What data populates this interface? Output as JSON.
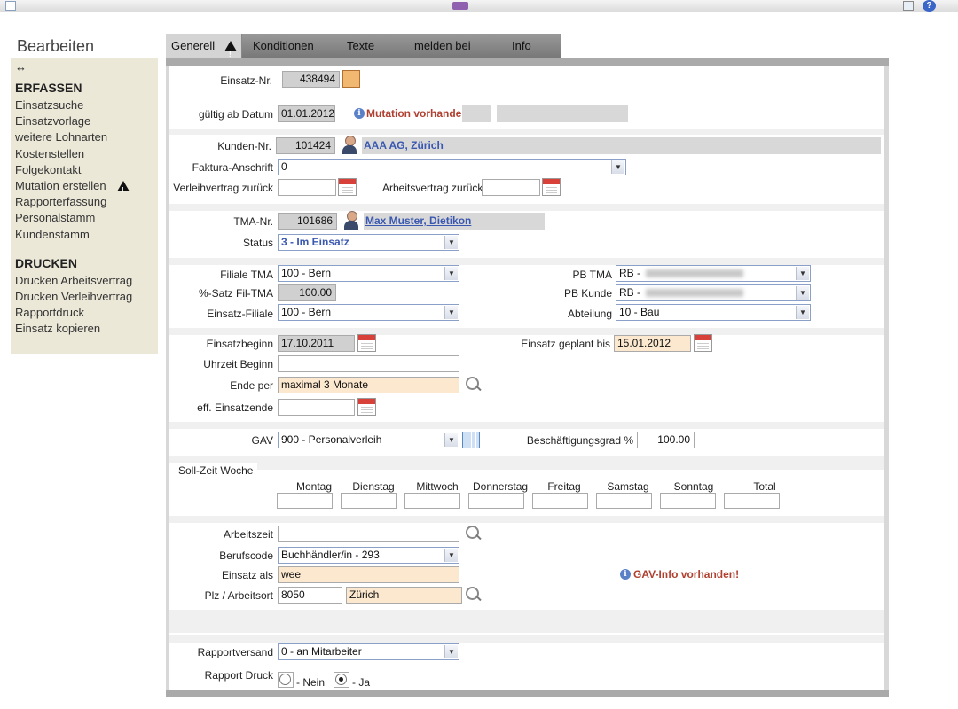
{
  "sidebar": {
    "title": "Bearbeiten",
    "resize_glyph": "↔",
    "sections": [
      {
        "heading": "ERFASSEN",
        "items": [
          "Einsatzsuche",
          "Einsatzvorlage",
          "weitere Lohnarten",
          "Kostenstellen",
          "Folgekontakt",
          "Mutation erstellen",
          "Rapporterfassung",
          "Personalstamm",
          "Kundenstamm"
        ]
      },
      {
        "heading": "DRUCKEN",
        "items": [
          "Drucken Arbeitsvertrag",
          "Drucken Verleihvertrag",
          "Rapportdruck",
          "Einsatz kopieren"
        ]
      }
    ]
  },
  "tabs": [
    "Generell",
    "Konditionen",
    "Texte",
    "melden bei",
    "Info"
  ],
  "form": {
    "einsatz_nr_label": "Einsatz-Nr.",
    "einsatz_nr": "438494",
    "gueltig_label": "gültig ab Datum",
    "gueltig": "01.01.2012",
    "mutation_text": "Mutation vorhanden",
    "kunden_nr_label": "Kunden-Nr.",
    "kunden_nr": "101424",
    "kunde_name": "AAA AG, Zürich",
    "faktura_label": "Faktura-Anschrift",
    "faktura": "0",
    "verleih_label": "Verleihvertrag zurück",
    "arbeits_label": "Arbeitsvertrag zurück",
    "tma_nr_label": "TMA-Nr.",
    "tma_nr": "101686",
    "tma_name": "Max Muster, Dietikon",
    "status_label": "Status",
    "status": "3 - Im Einsatz",
    "filiale_tma_label": "Filiale TMA",
    "filiale_tma": "100 - Bern",
    "satz_label": "%-Satz Fil-TMA",
    "satz": "100.00",
    "einsatz_filiale_label": "Einsatz-Filiale",
    "einsatz_filiale": "100 - Bern",
    "pb_tma_label": "PB TMA",
    "pb_tma": "RB -",
    "pb_kunde_label": "PB Kunde",
    "pb_kunde": "RB -",
    "abteilung_label": "Abteilung",
    "abteilung": "10 - Bau",
    "einsatzbeginn_label": "Einsatzbeginn",
    "einsatzbeginn": "17.10.2011",
    "geplant_label": "Einsatz geplant bis",
    "geplant": "15.01.2012",
    "uhrzeit_label": "Uhrzeit Beginn",
    "ende_label": "Ende per",
    "ende": "maximal 3 Monate",
    "eff_label": "eff. Einsatzende",
    "gav_label": "GAV",
    "gav": "900 - Personalverleih",
    "grad_label": "Beschäftigungsgrad %",
    "grad": "100.00",
    "soll_label": "Soll-Zeit Woche",
    "days": [
      "Montag",
      "Dienstag",
      "Mittwoch",
      "Donnerstag",
      "Freitag",
      "Samstag",
      "Sonntag",
      "Total"
    ],
    "arbeitszeit_label": "Arbeitszeit",
    "berufscode_label": "Berufscode",
    "berufscode": "Buchhändler/in - 293",
    "einsatz_als_label": "Einsatz als",
    "einsatz_als": "wee",
    "plz_label": "Plz / Arbeitsort",
    "plz": "8050",
    "ort": "Zürich",
    "gav_info": "GAV-Info vorhanden!",
    "rapportversand_label": "Rapportversand",
    "rapportversand": "0 - an Mitarbeiter",
    "rapport_druck_label": "Rapport Druck",
    "nein": "- Nein",
    "ja": "- Ja"
  }
}
